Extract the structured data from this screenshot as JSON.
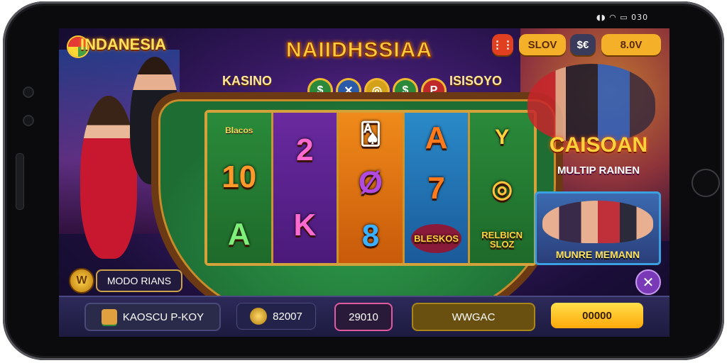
{
  "status_bar": {
    "icons": [
      "notification-icon",
      "wifi-icon",
      "battery-icon"
    ],
    "time": "030"
  },
  "brand": {
    "name": "INDANESIA"
  },
  "game": {
    "title": "NAIIDHSSIAA",
    "left_tag": "KASINO",
    "right_tag": "ISISOYO",
    "coin_glyphs": [
      "$",
      "✕",
      "◎",
      "$",
      "P"
    ]
  },
  "top_buttons": {
    "grid_icon": "grid-icon",
    "slov_label": "SLOV",
    "currency_label": "$€",
    "balance_label": "8.0V"
  },
  "reels": [
    {
      "top_label": "Blacos",
      "symbols": [
        "10",
        "A"
      ]
    },
    {
      "symbols": [
        "2",
        "K"
      ]
    },
    {
      "symbols": [
        "🂡",
        "Ø",
        "8"
      ]
    },
    {
      "symbols": [
        "A",
        "7",
        "BLESKOS"
      ]
    },
    {
      "symbols": [
        "Y",
        "◎",
        "RELBICN SLOZ"
      ]
    }
  ],
  "promo": {
    "title": "CAISOAN",
    "subtitle": "MULTIP RAINEN",
    "card_label": "MUNRE MEMANN"
  },
  "mode": {
    "label": "MODO RIANS",
    "badge": "W"
  },
  "bottom_bar": {
    "left_label": "KAOSCU P-KOY",
    "coin_value": "82007",
    "bet_value": "29010",
    "action_label": "WWGAC",
    "spin_label": "00000"
  },
  "colors": {
    "accent_gold": "#ffcd3c",
    "felt_green": "#2e9a4a",
    "purple_bg": "#3a1a66",
    "spin_yellow": "#ffc21a"
  }
}
